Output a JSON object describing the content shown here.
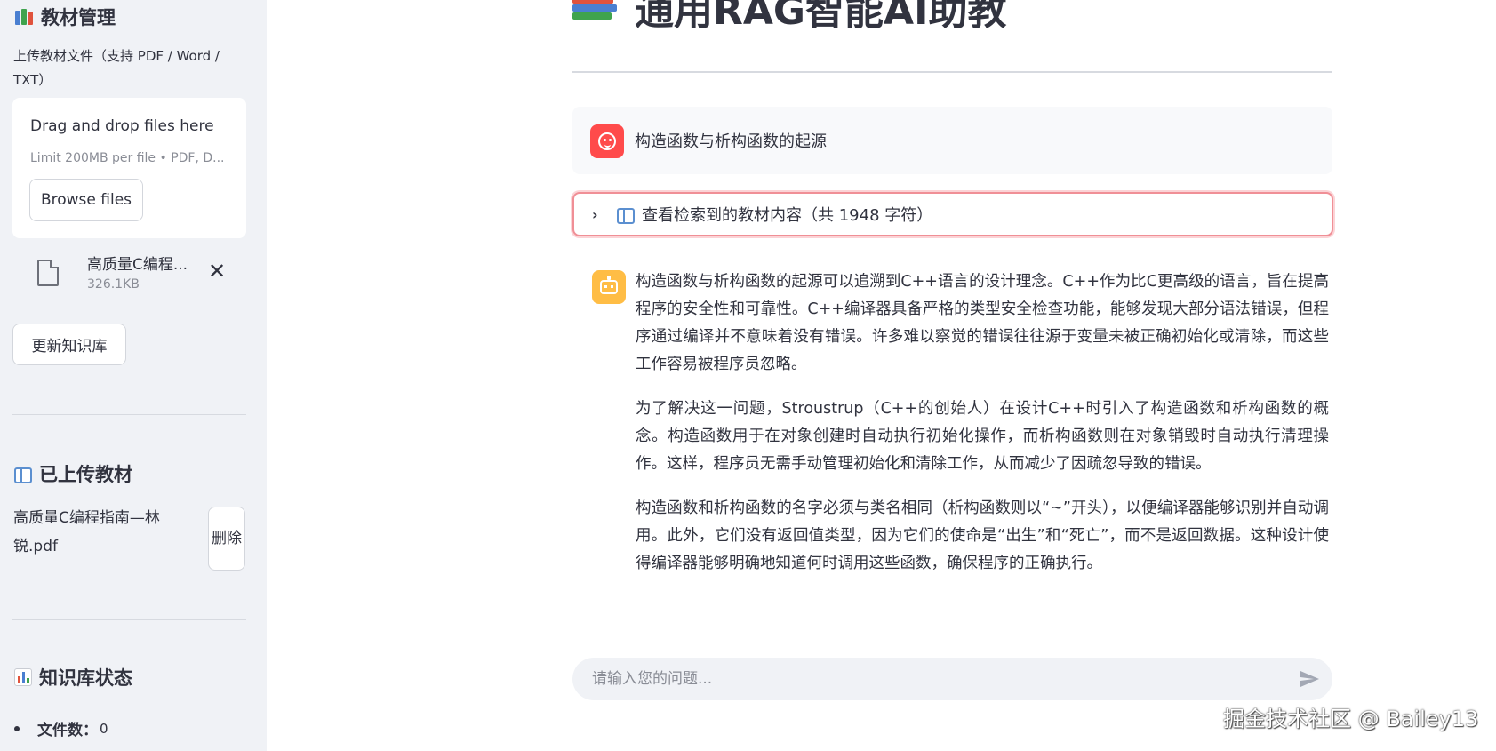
{
  "sidebar": {
    "manage_heading": "教材管理",
    "upload_label": "上传教材文件（支持 PDF / Word / TXT）",
    "dropzone": {
      "title": "Drag and drop files here",
      "limit": "Limit 200MB per file • PDF, D...",
      "browse_label": "Browse files"
    },
    "pending_file": {
      "name": "高质量C编程...",
      "size": "326.1KB"
    },
    "update_button": "更新知识库",
    "uploaded_heading": "已上传教材",
    "uploaded_file": "高质量C编程指南—林锐.pdf",
    "delete_button": "删除",
    "status_heading": "知识库状态",
    "status_items": [
      {
        "label": "文件数：",
        "value": "0"
      }
    ]
  },
  "main": {
    "title": "通用RAG智能AI助教",
    "user_message": "构造函数与析构函数的起源",
    "expander_label": "查看检索到的教材内容（共 1948 字符）",
    "assistant_paragraphs": [
      "构造函数与析构函数的起源可以追溯到C++语言的设计理念。C++作为比C更高级的语言，旨在提高程序的安全性和可靠性。C++编译器具备严格的类型安全检查功能，能够发现大部分语法错误，但程序通过编译并不意味着没有错误。许多难以察觉的错误往往源于变量未被正确初始化或清除，而这些工作容易被程序员忽略。",
      "为了解决这一问题，Stroustrup（C++的创始人）在设计C++时引入了构造函数和析构函数的概念。构造函数用于在对象创建时自动执行初始化操作，而析构函数则在对象销毁时自动执行清理操作。这样，程序员无需手动管理初始化和清除工作，从而减少了因疏忽导致的错误。",
      "构造函数和析构函数的名字必须与类名相同（析构函数则以“~”开头），以便编译器能够识别并自动调用。此外，它们没有返回值类型，因为它们的使命是“出生”和“死亡”，而不是返回数据。这种设计使得编译器能够明确地知道何时调用这些函数，确保程序的正确执行。"
    ],
    "chat_placeholder": "请输入您的问题..."
  },
  "watermark": "掘金技术社区 @ Bailey13",
  "colors": {
    "accent": "#ff4b4b",
    "bot_avatar": "#ffbd45",
    "sidebar_bg": "#f0f2f6",
    "text": "#31333f"
  },
  "icons": [
    "books-icon",
    "file-icon",
    "close-icon",
    "open-book-icon",
    "bar-chart-icon",
    "user-avatar-icon",
    "robot-avatar-icon",
    "chevron-right-icon",
    "send-icon"
  ]
}
